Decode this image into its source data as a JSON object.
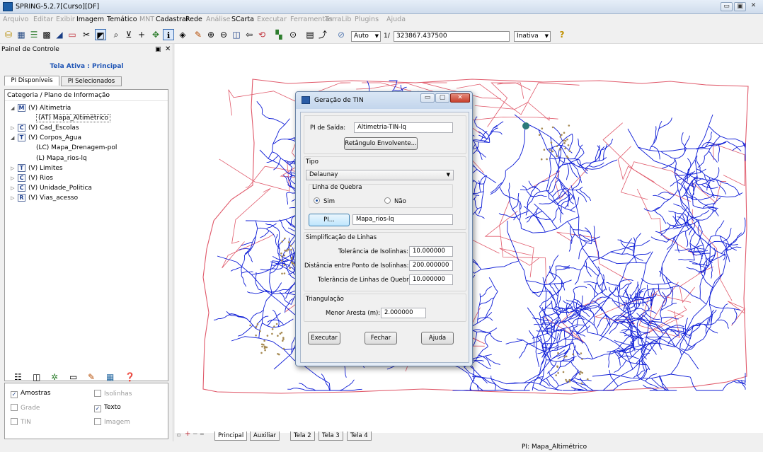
{
  "window": {
    "title": "SPRING-5.2.7[Curso][DF]"
  },
  "menu": {
    "items": [
      {
        "label": "Arquivo",
        "enabled": false
      },
      {
        "label": "Editar",
        "enabled": false
      },
      {
        "label": "Exibir",
        "enabled": false
      },
      {
        "label": "Imagem",
        "enabled": true
      },
      {
        "label": "Temático",
        "enabled": true
      },
      {
        "label": "MNT",
        "enabled": false
      },
      {
        "label": "Cadastral",
        "enabled": true
      },
      {
        "label": "Rede",
        "enabled": true
      },
      {
        "label": "Análise",
        "enabled": false
      },
      {
        "label": "SCarta",
        "enabled": true
      },
      {
        "label": "Executar",
        "enabled": false
      },
      {
        "label": "Ferramentas",
        "enabled": false
      },
      {
        "label": "TerraLib",
        "enabled": false
      },
      {
        "label": "Plugins",
        "enabled": false
      },
      {
        "label": "Ajuda",
        "enabled": false
      }
    ]
  },
  "toolbar": {
    "mode": "Auto",
    "scale_prefix": "1/",
    "scale": "323867.437500",
    "status": "Inativa"
  },
  "panel": {
    "title": "Painel de Controle",
    "active_screen": "Tela Ativa : Principal",
    "tabs": [
      "PI Disponíveis",
      "PI Selecionados"
    ],
    "tree_header": "Categoria / Plano de Informação",
    "tree": [
      {
        "label": "(V) Altimetria",
        "badge": "M",
        "expander": "◢"
      },
      {
        "label": "(AT) Mapa_Altimétrico",
        "badge": "",
        "expander": ""
      },
      {
        "label": "(V) Cad_Escolas",
        "badge": "C",
        "expander": "▷"
      },
      {
        "label": "(V) Corpos_Agua",
        "badge": "T",
        "expander": "◢"
      },
      {
        "label": "(LC) Mapa_Drenagem-pol",
        "badge": "",
        "expander": ""
      },
      {
        "label": "(L) Mapa_rios-lq",
        "badge": "",
        "expander": ""
      },
      {
        "label": "(V) Limites",
        "badge": "T",
        "expander": "▷"
      },
      {
        "label": "(V) Rios",
        "badge": "C",
        "expander": "▷"
      },
      {
        "label": "(V) Unidade_Politica",
        "badge": "C",
        "expander": "▷"
      },
      {
        "label": "(V) Vias_acesso",
        "badge": "R",
        "expander": "▷"
      }
    ],
    "checks": [
      {
        "label": "Amostras",
        "checked": true,
        "enabled": true
      },
      {
        "label": "Isolinhas",
        "checked": false,
        "enabled": false
      },
      {
        "label": "Grade",
        "checked": false,
        "enabled": false
      },
      {
        "label": "Texto",
        "checked": true,
        "enabled": true
      },
      {
        "label": "TIN",
        "checked": false,
        "enabled": false
      },
      {
        "label": "Imagem",
        "checked": false,
        "enabled": false
      }
    ]
  },
  "dialog": {
    "title": "Geração de TIN",
    "pi_saida_label": "PI de Saída:",
    "pi_saida_value": "Altimetria-TIN-lq",
    "retangulo_button": "Retângulo Envolvente...",
    "tipo_label": "Tipo",
    "tipo_value": "Delaunay",
    "linha_quebra_label": "Linha de Quebra",
    "radio_sim": "Sim",
    "radio_nao": "Não",
    "radio_selected": "Sim",
    "pi_button": "PI...",
    "pi_value": "Mapa_rios-lq",
    "simplificacao_label": "Simplificação de Linhas",
    "tol_isolinhas_label": "Tolerância de Isolinhas:",
    "tol_isolinhas_value": "10.000000",
    "dist_pontos_label": "Distância entre Ponto de Isolinhas:",
    "dist_pontos_value": "200.000000",
    "tol_quebra_label": "Tolerância de Linhas de Quebra:",
    "tol_quebra_value": "10.000000",
    "triangulacao_label": "Triangulação",
    "menor_aresta_label": "Menor Aresta (m):",
    "menor_aresta_value": "2.000000",
    "executar": "Executar",
    "fechar": "Fechar",
    "ajuda": "Ajuda"
  },
  "bottom_tabs": [
    "Principal",
    "Auxiliar",
    "Tela 2",
    "Tela 3",
    "Tela 4"
  ],
  "status_text": "PI: Mapa_Altimétrico",
  "colors": {
    "drainage": "#0b1ad6",
    "boundaries": "#e0596a",
    "samples": "#a68a52"
  }
}
